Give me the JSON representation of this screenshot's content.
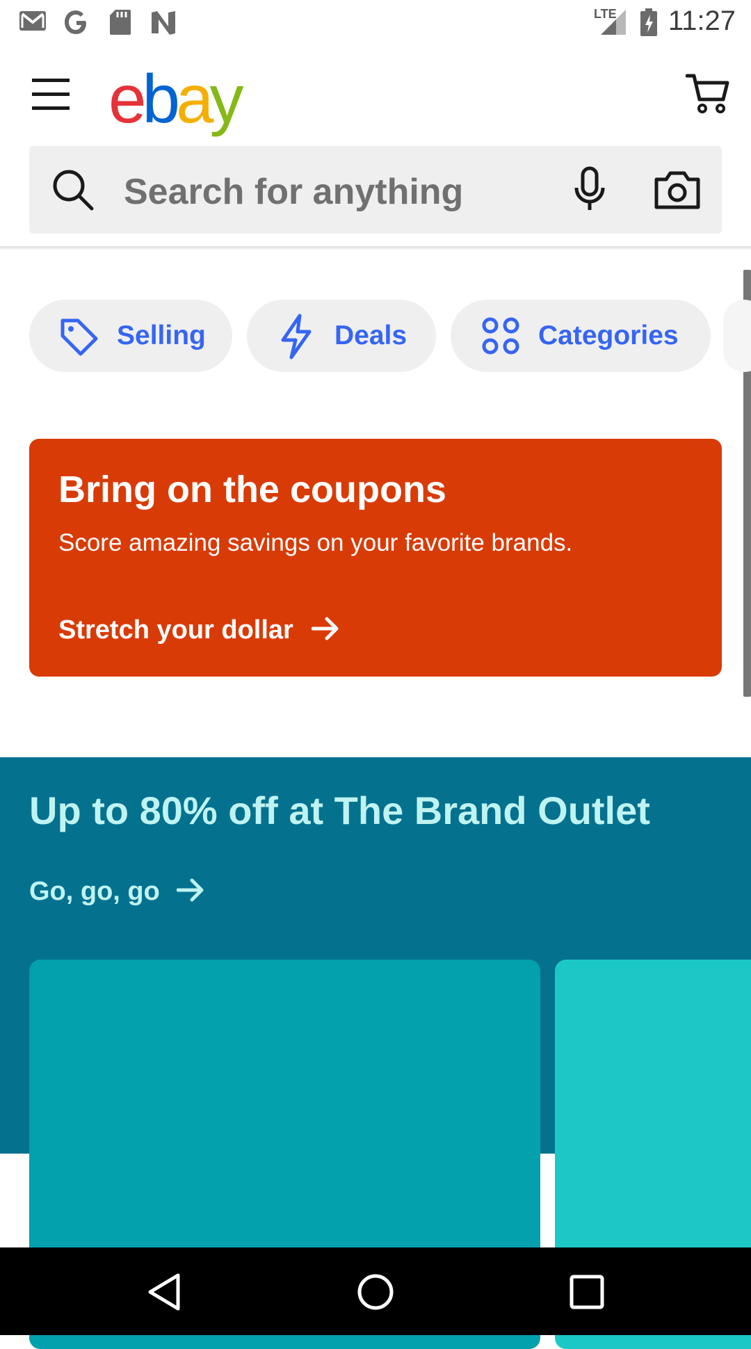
{
  "status_bar": {
    "time": "11:27",
    "network": "LTE",
    "left_icons": [
      "gmail-icon",
      "google-icon",
      "sd-card-icon",
      "n-app-icon"
    ],
    "right_icons": [
      "signal-icon",
      "battery-charging-icon"
    ]
  },
  "app_bar": {
    "logo": [
      "e",
      "b",
      "a",
      "y"
    ],
    "logo_colors": [
      "#e53238",
      "#0064d2",
      "#f5af02",
      "#86b817"
    ],
    "menu_icon": "hamburger-menu-icon",
    "cart_icon": "cart-icon"
  },
  "search": {
    "placeholder": "Search for anything",
    "icons": [
      "search-icon",
      "microphone-icon",
      "camera-icon"
    ]
  },
  "chips": [
    {
      "label": "Selling",
      "icon": "tag-icon"
    },
    {
      "label": "Deals",
      "icon": "lightning-icon"
    },
    {
      "label": "Categories",
      "icon": "grid-circles-icon"
    }
  ],
  "coupon_banner": {
    "title": "Bring on the coupons",
    "subtitle": "Score amazing savings on your favorite brands.",
    "cta": "Stretch your dollar",
    "color": "#d93b06"
  },
  "brand_outlet": {
    "title": "Up to 80% off at The Brand Outlet",
    "cta": "Go, go, go",
    "color": "#04718f"
  },
  "colors": {
    "accent": "#3665f3",
    "chip_bg": "#efefef"
  }
}
